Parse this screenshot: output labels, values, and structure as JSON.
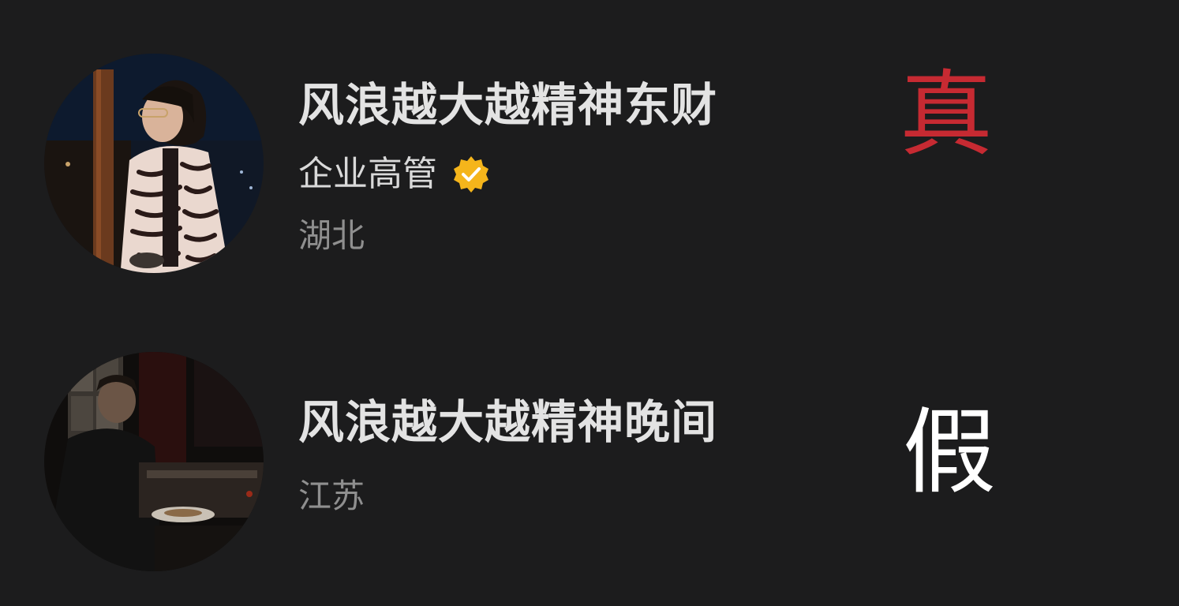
{
  "colors": {
    "background": "#1c1c1d",
    "name_text": "#e3e3e3",
    "region_text": "#8f8f8f",
    "verified_badge": "#f5b51b",
    "verdict_true": "#c62a32",
    "verdict_false": "#ffffff"
  },
  "profiles": [
    {
      "name": "风浪越大越精神东财",
      "role": "企业高管",
      "verified_icon": "verified-check-icon",
      "region": "湖北",
      "verdict": "真"
    },
    {
      "name": "风浪越大越精神晚间",
      "region": "江苏",
      "verdict": "假"
    }
  ]
}
